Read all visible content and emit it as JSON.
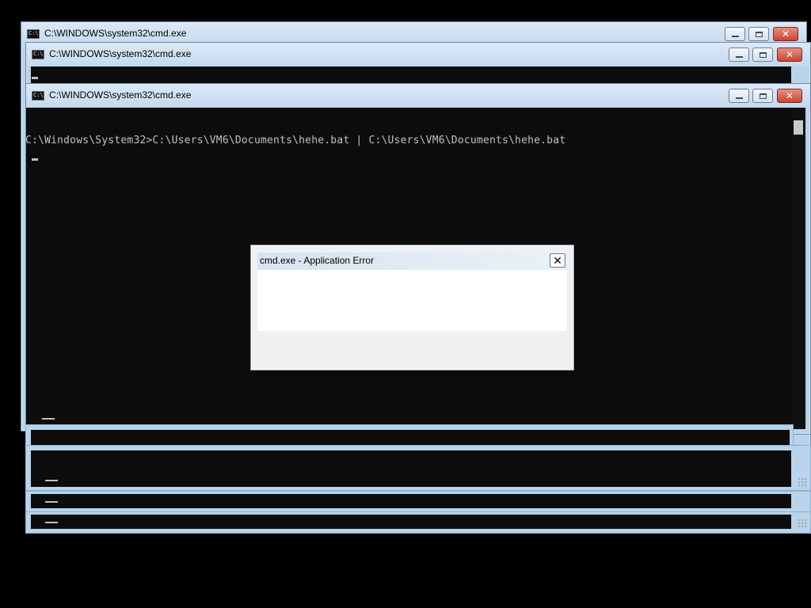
{
  "windows": [
    {
      "title": "C:\\WINDOWS\\system32\\cmd.exe"
    },
    {
      "title": "C:\\WINDOWS\\system32\\cmd.exe"
    },
    {
      "title": "C:\\WINDOWS\\system32\\cmd.exe"
    }
  ],
  "console": {
    "lines": [
      "C:\\Windows\\System32>C:\\Users\\VM6\\Documents\\hehe.bat | C:\\Users\\VM6\\Documents\\hehe.bat"
    ]
  },
  "dialog": {
    "title": "cmd.exe - Application Error",
    "close_glyph": "✕"
  },
  "icons": {
    "app": "console-app-icon",
    "minimize": "minimize-icon",
    "maximize": "maximize-icon",
    "close": "close-icon",
    "grip": "resize-grip-icon"
  },
  "colors": {
    "frame": "#b9d3ea",
    "console_bg": "#0c0c0c",
    "console_text": "#c0c0c0",
    "close_button": "#c9442f"
  }
}
